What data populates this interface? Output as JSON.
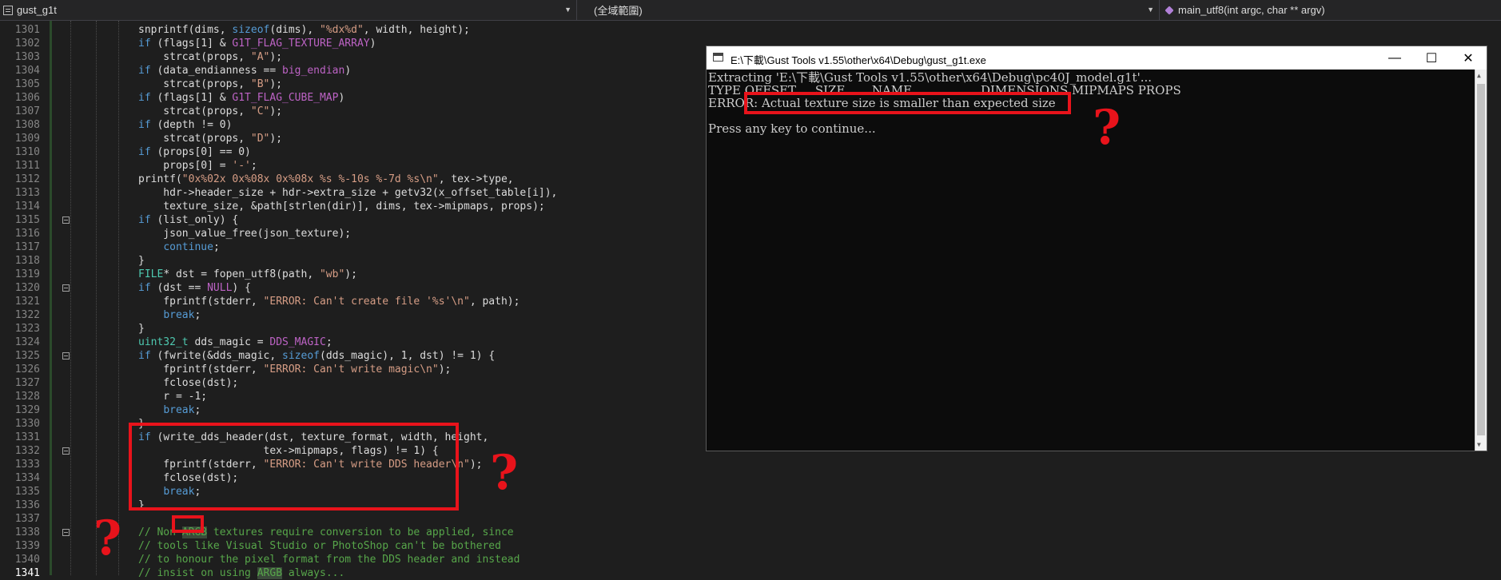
{
  "navbar": {
    "file": "gust_g1t",
    "scope": "(全域範圍)",
    "function": "main_utf8(int argc, char ** argv)"
  },
  "editor": {
    "lines": [
      {
        "n": "1301",
        "code": [
          {
            "t": "snprintf(dims, "
          },
          {
            "t": "sizeof",
            "c": "kw"
          },
          {
            "t": "(dims), "
          },
          {
            "t": "\"%dx%d\"",
            "c": "str"
          },
          {
            "t": ", width, height);"
          }
        ]
      },
      {
        "n": "1302",
        "code": [
          {
            "t": "if",
            "c": "kw"
          },
          {
            "t": " (flags[1] & "
          },
          {
            "t": "G1T_FLAG_TEXTURE_ARRAY",
            "c": "mac"
          },
          {
            "t": ")"
          }
        ]
      },
      {
        "n": "1303",
        "code": [
          {
            "t": "    strcat(props, "
          },
          {
            "t": "\"A\"",
            "c": "str"
          },
          {
            "t": ");"
          }
        ]
      },
      {
        "n": "1304",
        "code": [
          {
            "t": "if",
            "c": "kw"
          },
          {
            "t": " (data_endianness == "
          },
          {
            "t": "big_endian",
            "c": "mac"
          },
          {
            "t": ")"
          }
        ]
      },
      {
        "n": "1305",
        "code": [
          {
            "t": "    strcat(props, "
          },
          {
            "t": "\"B\"",
            "c": "str"
          },
          {
            "t": ");"
          }
        ]
      },
      {
        "n": "1306",
        "code": [
          {
            "t": "if",
            "c": "kw"
          },
          {
            "t": " (flags[1] & "
          },
          {
            "t": "G1T_FLAG_CUBE_MAP",
            "c": "mac"
          },
          {
            "t": ")"
          }
        ]
      },
      {
        "n": "1307",
        "code": [
          {
            "t": "    strcat(props, "
          },
          {
            "t": "\"C\"",
            "c": "str"
          },
          {
            "t": ");"
          }
        ]
      },
      {
        "n": "1308",
        "code": [
          {
            "t": "if",
            "c": "kw"
          },
          {
            "t": " (depth != 0)"
          }
        ]
      },
      {
        "n": "1309",
        "code": [
          {
            "t": "    strcat(props, "
          },
          {
            "t": "\"D\"",
            "c": "str"
          },
          {
            "t": ");"
          }
        ]
      },
      {
        "n": "1310",
        "code": [
          {
            "t": "if",
            "c": "kw"
          },
          {
            "t": " (props[0] == 0)"
          }
        ]
      },
      {
        "n": "1311",
        "code": [
          {
            "t": "    props[0] = "
          },
          {
            "t": "'-'",
            "c": "str"
          },
          {
            "t": ";"
          }
        ]
      },
      {
        "n": "1312",
        "code": [
          {
            "t": "printf("
          },
          {
            "t": "\"0x%02x 0x%08x 0x%08x %s %-10s %-7d %s\\n\"",
            "c": "str"
          },
          {
            "t": ", tex->type,"
          }
        ]
      },
      {
        "n": "1313",
        "code": [
          {
            "t": "    hdr->header_size + hdr->extra_size + getv32(x_offset_table[i]),"
          }
        ]
      },
      {
        "n": "1314",
        "code": [
          {
            "t": "    texture_size, &path[strlen(dir)], dims, tex->mipmaps, props);"
          }
        ]
      },
      {
        "n": "1315",
        "fold": true,
        "code": [
          {
            "t": "if",
            "c": "kw"
          },
          {
            "t": " (list_only) {"
          }
        ]
      },
      {
        "n": "1316",
        "code": [
          {
            "t": "    json_value_free(json_texture);"
          }
        ]
      },
      {
        "n": "1317",
        "code": [
          {
            "t": "    "
          },
          {
            "t": "continue",
            "c": "kw"
          },
          {
            "t": ";"
          }
        ]
      },
      {
        "n": "1318",
        "code": [
          {
            "t": "}"
          }
        ]
      },
      {
        "n": "1319",
        "code": [
          {
            "t": "FILE",
            "c": "ty"
          },
          {
            "t": "* dst = fopen_utf8(path, "
          },
          {
            "t": "\"wb\"",
            "c": "str"
          },
          {
            "t": ");"
          }
        ]
      },
      {
        "n": "1320",
        "fold": true,
        "code": [
          {
            "t": "if",
            "c": "kw"
          },
          {
            "t": " (dst == "
          },
          {
            "t": "NULL",
            "c": "mac"
          },
          {
            "t": ") {"
          }
        ]
      },
      {
        "n": "1321",
        "code": [
          {
            "t": "    fprintf(stderr, "
          },
          {
            "t": "\"ERROR: Can't create file '%s'\\n\"",
            "c": "str"
          },
          {
            "t": ", path);"
          }
        ]
      },
      {
        "n": "1322",
        "code": [
          {
            "t": "    "
          },
          {
            "t": "break",
            "c": "kw"
          },
          {
            "t": ";"
          }
        ]
      },
      {
        "n": "1323",
        "code": [
          {
            "t": "}"
          }
        ]
      },
      {
        "n": "1324",
        "code": [
          {
            "t": "uint32_t",
            "c": "ty"
          },
          {
            "t": " dds_magic = "
          },
          {
            "t": "DDS_MAGIC",
            "c": "mac"
          },
          {
            "t": ";"
          }
        ]
      },
      {
        "n": "1325",
        "fold": true,
        "code": [
          {
            "t": "if",
            "c": "kw"
          },
          {
            "t": " (fwrite(&dds_magic, "
          },
          {
            "t": "sizeof",
            "c": "kw"
          },
          {
            "t": "(dds_magic), 1, dst) != 1) {"
          }
        ]
      },
      {
        "n": "1326",
        "code": [
          {
            "t": "    fprintf(stderr, "
          },
          {
            "t": "\"ERROR: Can't write magic\\n\"",
            "c": "str"
          },
          {
            "t": ");"
          }
        ]
      },
      {
        "n": "1327",
        "code": [
          {
            "t": "    fclose(dst);"
          }
        ]
      },
      {
        "n": "1328",
        "code": [
          {
            "t": "    r = -1;"
          }
        ]
      },
      {
        "n": "1329",
        "code": [
          {
            "t": "    "
          },
          {
            "t": "break",
            "c": "kw"
          },
          {
            "t": ";"
          }
        ]
      },
      {
        "n": "1330",
        "code": [
          {
            "t": "}"
          }
        ]
      },
      {
        "n": "1331",
        "code": [
          {
            "t": "if",
            "c": "kw"
          },
          {
            "t": " (write_dds_header(dst, texture_format, width, height,"
          }
        ]
      },
      {
        "n": "1332",
        "fold": true,
        "code": [
          {
            "t": "                    tex->mipmaps, flags) != 1) {"
          }
        ]
      },
      {
        "n": "1333",
        "code": [
          {
            "t": "    fprintf(stderr, "
          },
          {
            "t": "\"ERROR: Can't write DDS header\\n\"",
            "c": "str"
          },
          {
            "t": ");"
          }
        ]
      },
      {
        "n": "1334",
        "code": [
          {
            "t": "    fclose(dst);"
          }
        ]
      },
      {
        "n": "1335",
        "code": [
          {
            "t": "    "
          },
          {
            "t": "break",
            "c": "kw"
          },
          {
            "t": ";"
          }
        ]
      },
      {
        "n": "1336",
        "code": [
          {
            "t": "}"
          }
        ]
      },
      {
        "n": "1337",
        "code": [
          {
            "t": ""
          }
        ]
      },
      {
        "n": "1338",
        "fold": true,
        "code": [
          {
            "t": "// Non ",
            "c": "com"
          },
          {
            "t": "ARGB",
            "c": "com",
            "h": "hl2"
          },
          {
            "t": " textures require conversion to be applied, since",
            "c": "com"
          }
        ]
      },
      {
        "n": "1339",
        "code": [
          {
            "t": "// tools like Visual Studio or PhotoShop can't be bothered",
            "c": "com"
          }
        ]
      },
      {
        "n": "1340",
        "code": [
          {
            "t": "// to honour the pixel format from the DDS header and instead",
            "c": "com"
          }
        ]
      },
      {
        "n": "1341",
        "cur": true,
        "code": [
          {
            "t": "// insist on using ",
            "c": "com"
          },
          {
            "t": "ARGB",
            "c": "com",
            "h": "hl2"
          },
          {
            "t": " always...",
            "c": "com"
          }
        ]
      }
    ]
  },
  "console": {
    "title": "E:\\下載\\Gust Tools v1.55\\other\\x64\\Debug\\gust_g1t.exe",
    "lines": [
      "Extracting 'E:\\下載\\Gust Tools v1.55\\other\\x64\\Debug\\pc40J_model.g1t'...",
      "TYPE OFFSET     SIZE       NAME                  DIMENSIONS MIPMAPS PROPS",
      "ERROR: Actual texture size is smaller than expected size",
      "",
      "Press any key to continue..."
    ],
    "buttons": {
      "minimize": "—",
      "maximize": "☐",
      "close": "✕"
    }
  },
  "annotations": {
    "question_mark": "?",
    "color": "#e8131b"
  },
  "colors": {
    "keyword": "#569cd6",
    "string": "#d69d85",
    "comment": "#57a64a",
    "type": "#4ec9b0",
    "macro": "#bd63c5",
    "editor_bg": "#1e1e1e",
    "console_bg": "#0c0c0c"
  }
}
